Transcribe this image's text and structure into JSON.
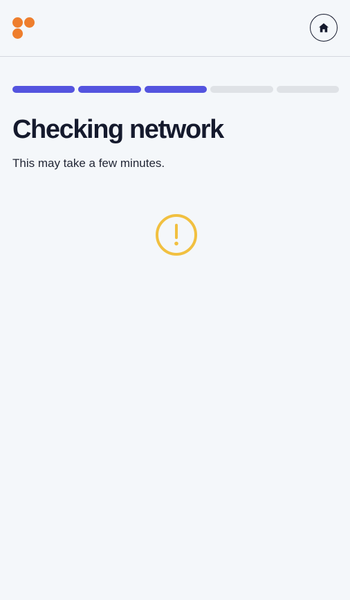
{
  "header": {
    "logo_icon": "four-dots-logo",
    "home_icon": "home-icon"
  },
  "progress": {
    "total_steps": 5,
    "completed_steps": 3,
    "active_color": "#5454df",
    "inactive_color": "#dfe2e6"
  },
  "main": {
    "title": "Checking network",
    "subtitle": "This may take a few minutes.",
    "status_icon": "warning-exclamation-icon",
    "status_color": "#f1c040"
  },
  "colors": {
    "brand": "#ee7e2d",
    "background": "#f4f7fa",
    "text": "#151a2d"
  }
}
